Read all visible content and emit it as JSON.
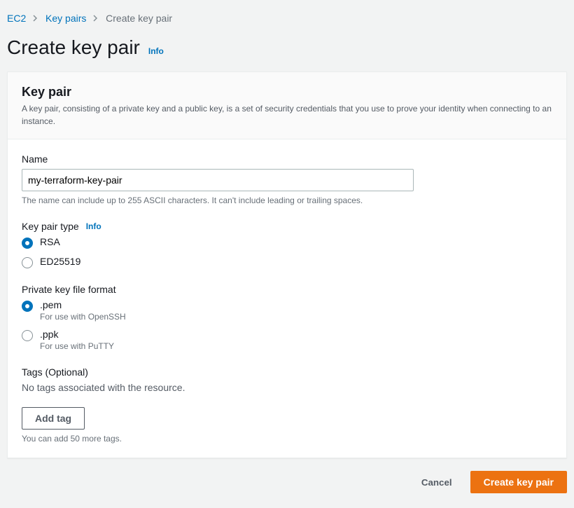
{
  "breadcrumb": {
    "items": [
      "EC2",
      "Key pairs",
      "Create key pair"
    ]
  },
  "page": {
    "title": "Create key pair",
    "info": "Info"
  },
  "panel": {
    "title": "Key pair",
    "description": "A key pair, consisting of a private key and a public key, is a set of security credentials that you use to prove your identity when connecting to an instance."
  },
  "name_field": {
    "label": "Name",
    "value": "my-terraform-key-pair",
    "hint": "The name can include up to 255 ASCII characters. It can't include leading or trailing spaces."
  },
  "type_field": {
    "label": "Key pair type",
    "info": "Info",
    "options": [
      {
        "label": "RSA",
        "selected": true
      },
      {
        "label": "ED25519",
        "selected": false
      }
    ]
  },
  "format_field": {
    "label": "Private key file format",
    "options": [
      {
        "label": ".pem",
        "desc": "For use with OpenSSH",
        "selected": true
      },
      {
        "label": ".ppk",
        "desc": "For use with PuTTY",
        "selected": false
      }
    ]
  },
  "tags": {
    "label": "Tags (Optional)",
    "empty": "No tags associated with the resource.",
    "add_button": "Add tag",
    "hint": "You can add 50 more tags."
  },
  "footer": {
    "cancel": "Cancel",
    "submit": "Create key pair"
  }
}
